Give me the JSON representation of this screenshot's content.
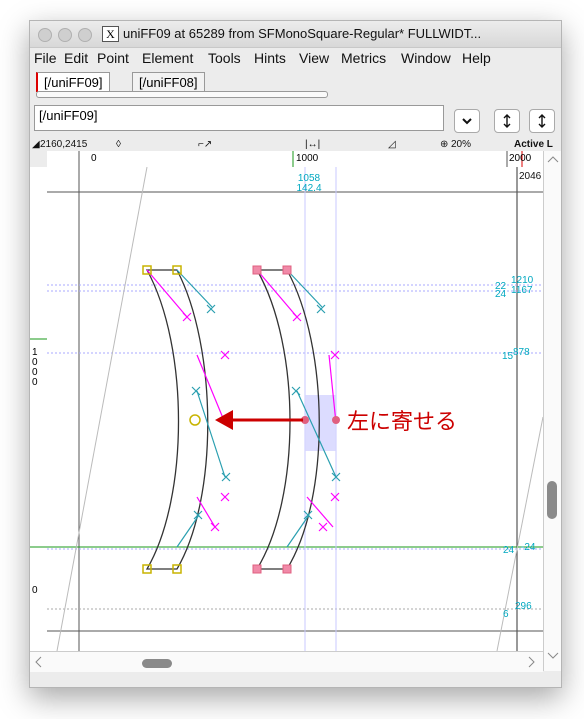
{
  "window": {
    "title": "uniFF09 at 65289 from SFMonoSquare-Regular* FULLWIDT...",
    "x_glyph": "X"
  },
  "menubar": [
    "File",
    "Edit",
    "Point",
    "Element",
    "Tools",
    "Hints",
    "View",
    "Metrics",
    "Window",
    "Help"
  ],
  "tabs": [
    "[/uniFF09]",
    "[/uniFF08]"
  ],
  "glyph_field": "[/uniFF09]",
  "infobar": {
    "coords": "2160,2415",
    "zoom": "20%",
    "active_layer": "Active L"
  },
  "ruler_top": {
    "labels": [
      "0",
      "1000",
      "2000"
    ],
    "width_readout": "2046"
  },
  "ruler_left": {
    "labels": [
      "1",
      "0",
      "0",
      "0",
      "0"
    ]
  },
  "canvas": {
    "annotation": "左に寄せる",
    "point_pos_x": "1058",
    "point_pos_y": "142.4",
    "hint_labels": [
      {
        "a": "22",
        "b": "1210"
      },
      {
        "a": "24",
        "b": "1167"
      },
      {
        "a": "15",
        "b": "878"
      },
      {
        "a": "24",
        "b": "-24"
      },
      {
        "a": "6",
        "b": "296"
      }
    ]
  },
  "colors": {
    "arrow": "#cc0000",
    "annotation_text": "#cc0000",
    "hint": "#00bcd4",
    "control_point": "#ff00ff",
    "x_marker": "#2a9fb0"
  }
}
